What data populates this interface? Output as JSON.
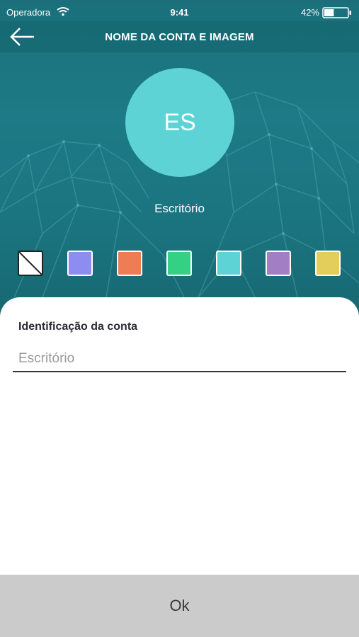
{
  "status_bar": {
    "carrier": "Operadora",
    "time": "9:41",
    "battery_percent": "42%",
    "battery_level": 0.42
  },
  "header": {
    "title": "NOME DA CONTA E IMAGEM",
    "back_icon": "arrow-left-icon"
  },
  "profile": {
    "initials": "ES",
    "name": "Escritório",
    "avatar_color": "#5ed3d6"
  },
  "colors": {
    "hero_background": "#1b7580",
    "swatches": [
      {
        "id": "none",
        "color": "none"
      },
      {
        "id": "lavender",
        "color": "#8d8cf0"
      },
      {
        "id": "orange",
        "color": "#ee7c55"
      },
      {
        "id": "green",
        "color": "#34d084"
      },
      {
        "id": "turquoise",
        "color": "#5ed3d6"
      },
      {
        "id": "purple",
        "color": "#a27fc4"
      },
      {
        "id": "yellow",
        "color": "#e3cd5b"
      }
    ]
  },
  "form": {
    "label": "Identificação da conta",
    "value": "",
    "placeholder": "Escritório"
  },
  "actions": {
    "ok_label": "Ok"
  }
}
